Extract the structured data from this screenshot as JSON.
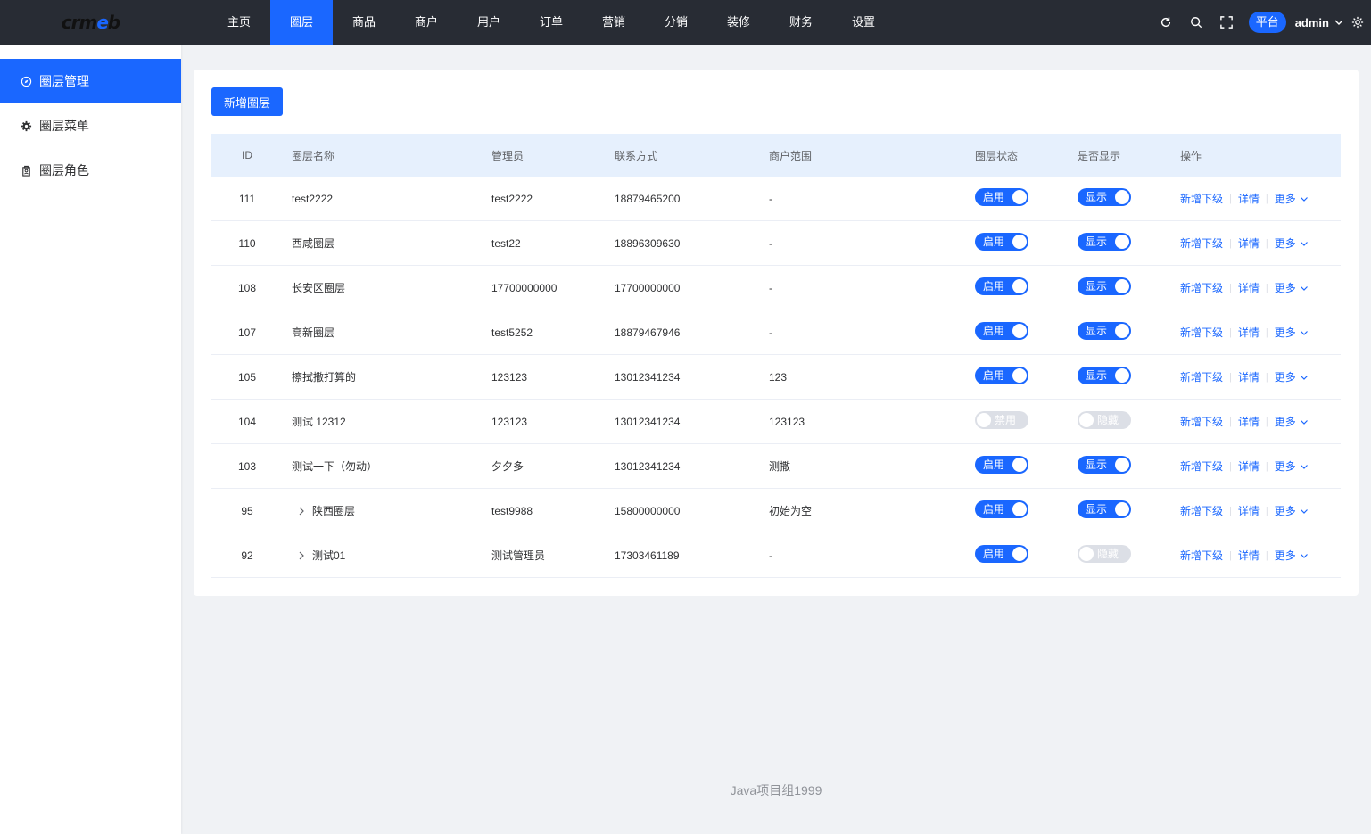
{
  "logo": {
    "part1": "crm",
    "part2": "e",
    "part3": "b"
  },
  "nav": [
    "主页",
    "圈层",
    "商品",
    "商户",
    "用户",
    "订单",
    "营销",
    "分销",
    "装修",
    "财务",
    "设置"
  ],
  "header": {
    "platform": "平台",
    "user": "admin"
  },
  "sidebar": {
    "items": [
      {
        "label": "圈层管理",
        "icon": "compass-icon"
      },
      {
        "label": "圈层菜单",
        "icon": "gear-icon"
      },
      {
        "label": "圈层角色",
        "icon": "badge-icon"
      }
    ]
  },
  "toolbar": {
    "add_label": "新增圈层"
  },
  "table": {
    "columns": [
      "ID",
      "圈层名称",
      "管理员",
      "联系方式",
      "商户范围",
      "圈层状态",
      "是否显示",
      "操作"
    ],
    "rows": [
      {
        "id": "111",
        "name": "test2222",
        "admin": "test2222",
        "phone": "18879465200",
        "range": "-",
        "status": "启用",
        "status_on": true,
        "show": "显示",
        "show_on": true,
        "expandable": false
      },
      {
        "id": "110",
        "name": "西咸圈层",
        "admin": "test22",
        "phone": "18896309630",
        "range": "-",
        "status": "启用",
        "status_on": true,
        "show": "显示",
        "show_on": true,
        "expandable": false
      },
      {
        "id": "108",
        "name": "长安区圈层",
        "admin": "17700000000",
        "phone": "17700000000",
        "range": "-",
        "status": "启用",
        "status_on": true,
        "show": "显示",
        "show_on": true,
        "expandable": false
      },
      {
        "id": "107",
        "name": "高新圈层",
        "admin": "test5252",
        "phone": "18879467946",
        "range": "-",
        "status": "启用",
        "status_on": true,
        "show": "显示",
        "show_on": true,
        "expandable": false
      },
      {
        "id": "105",
        "name": "擦拭撒打算的",
        "admin": "123123",
        "phone": "13012341234",
        "range": "123",
        "status": "启用",
        "status_on": true,
        "show": "显示",
        "show_on": true,
        "expandable": false
      },
      {
        "id": "104",
        "name": "测试 12312",
        "admin": "123123",
        "phone": "13012341234",
        "range": "123123",
        "status": "禁用",
        "status_on": false,
        "show": "隐藏",
        "show_on": false,
        "expandable": false
      },
      {
        "id": "103",
        "name": "测试一下（勿动）",
        "admin": "夕夕多",
        "phone": "13012341234",
        "range": "测撒",
        "status": "启用",
        "status_on": true,
        "show": "显示",
        "show_on": true,
        "expandable": false
      },
      {
        "id": "95",
        "name": "陕西圈层",
        "admin": "test9988",
        "phone": "15800000000",
        "range": "初始为空",
        "status": "启用",
        "status_on": true,
        "show": "显示",
        "show_on": true,
        "expandable": true
      },
      {
        "id": "92",
        "name": "测试01",
        "admin": "测试管理员",
        "phone": "17303461189",
        "range": "-",
        "status": "启用",
        "status_on": true,
        "show": "隐藏",
        "show_on": false,
        "expandable": true
      }
    ],
    "ops": {
      "add_child": "新增下级",
      "detail": "详情",
      "more": "更多",
      "sep": "|"
    }
  },
  "footer": {
    "text": "Java项目组1999"
  },
  "colors": {
    "accent": "#1a67ff",
    "topbar": "#282c34",
    "header_row": "#e6f0fd"
  }
}
